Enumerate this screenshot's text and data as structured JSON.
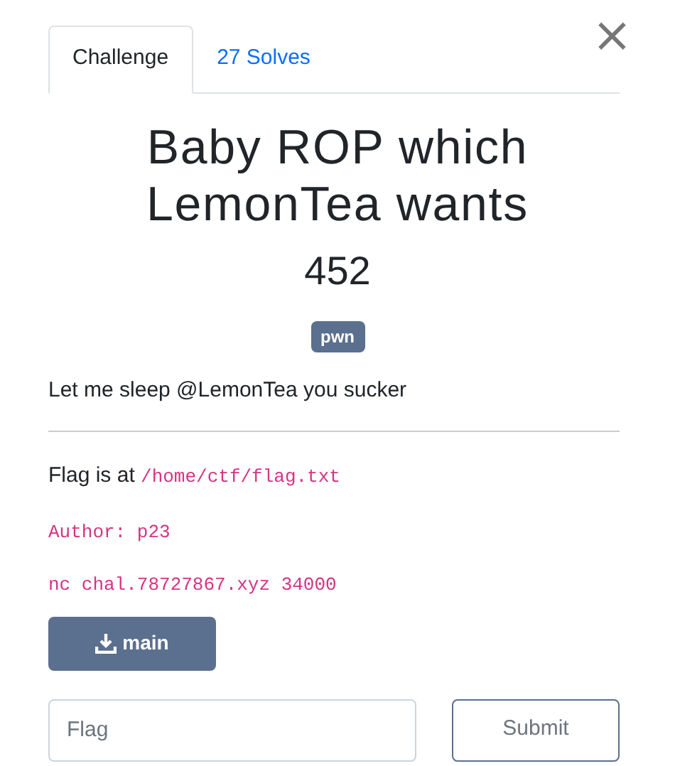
{
  "tabs": [
    {
      "label": "Challenge",
      "selected": true
    },
    {
      "label": "27 Solves",
      "selected": false
    }
  ],
  "close": "×",
  "title": "Baby ROP which LemonTea wants",
  "points": "452",
  "tags": [
    "pwn"
  ],
  "description": "Let me sleep @LemonTea you sucker",
  "details": [
    {
      "kind": "mixed",
      "text": "Flag is at ",
      "code": "/home/ctf/flag.txt"
    },
    {
      "kind": "code",
      "code": "Author: p23"
    },
    {
      "kind": "code",
      "code": "nc chal.78727867.xyz 34000"
    }
  ],
  "files": [
    {
      "label": "main"
    }
  ],
  "flag_field": {
    "placeholder": "Flag"
  },
  "submit": "Submit"
}
